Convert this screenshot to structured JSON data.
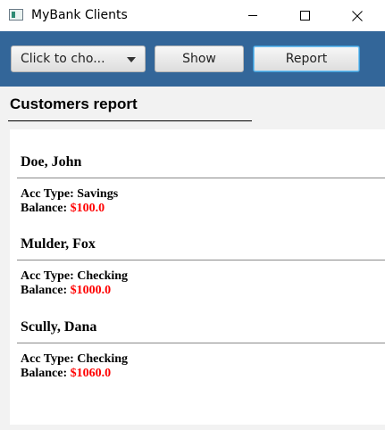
{
  "window": {
    "title": "MyBank Clients"
  },
  "toolbar": {
    "choice_placeholder": "Click to cho...",
    "show_label": "Show",
    "report_label": "Report"
  },
  "report": {
    "heading": "Customers report",
    "customers": [
      {
        "name": "Doe, John",
        "acc_label": "Acc Type:",
        "acc_type": "Savings",
        "balance_label": "Balance:",
        "balance": "$100.0"
      },
      {
        "name": "Mulder, Fox",
        "acc_label": "Acc Type:",
        "acc_type": "Checking",
        "balance_label": "Balance:",
        "balance": "$1000.0"
      },
      {
        "name": "Scully, Dana",
        "acc_label": "Acc Type:",
        "acc_type": "Checking",
        "balance_label": "Balance:",
        "balance": "$1060.0"
      }
    ]
  },
  "colors": {
    "toolbar_bg": "#336699",
    "balance_value": "#ff0000"
  }
}
